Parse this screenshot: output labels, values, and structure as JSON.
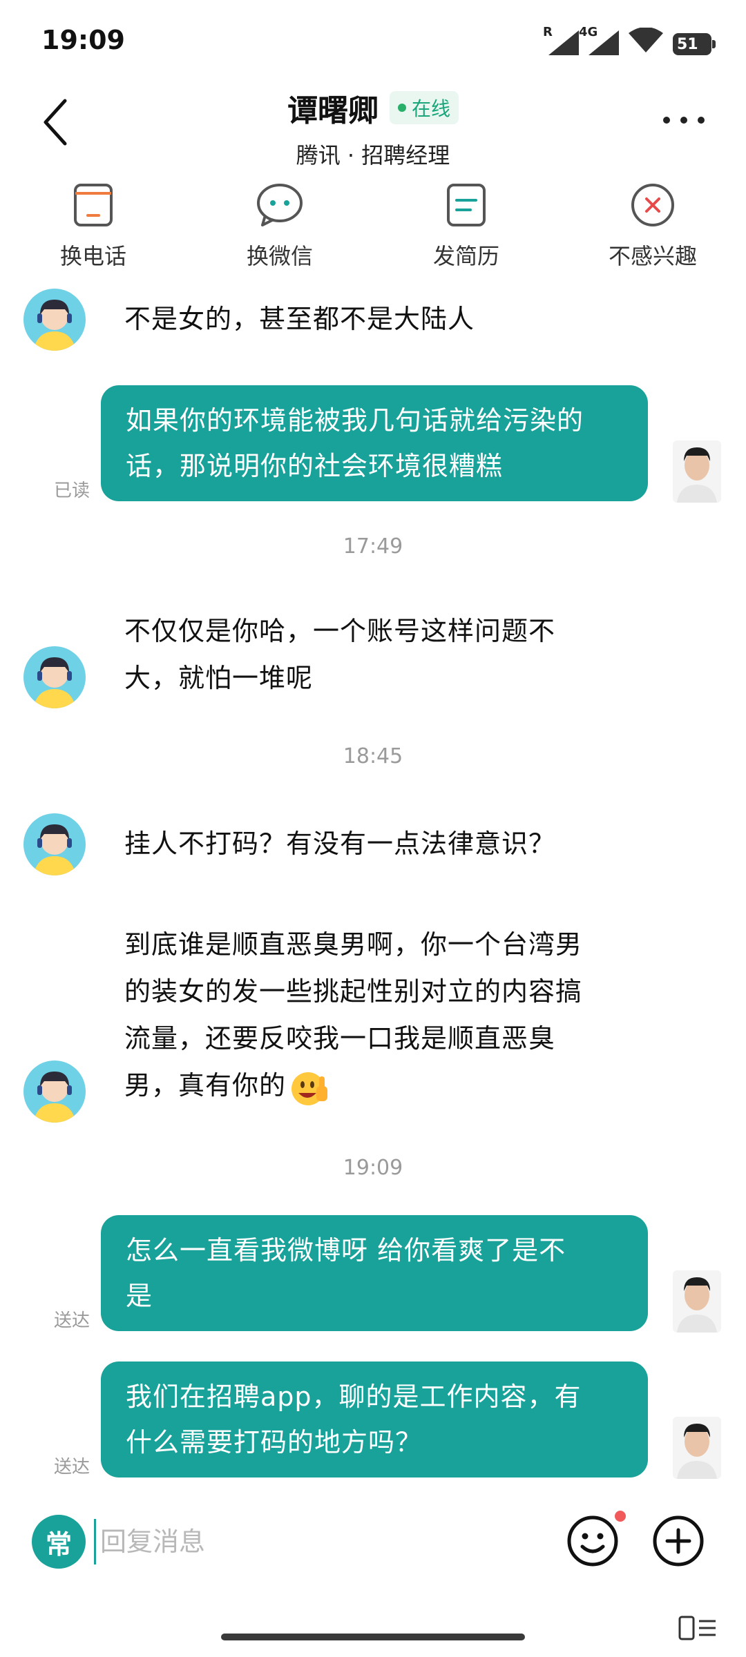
{
  "status_bar": {
    "time": "19:09",
    "signal1_tag": "R",
    "signal2_tag": "4G",
    "battery": "51"
  },
  "header": {
    "name": "谭曙卿",
    "online": "在线",
    "subtitle": "腾讯 · 招聘经理"
  },
  "actions": [
    {
      "label": "换电话",
      "icon": "phone-icon"
    },
    {
      "label": "换微信",
      "icon": "wechat-icon"
    },
    {
      "label": "发简历",
      "icon": "resume-icon"
    },
    {
      "label": "不感兴趣",
      "icon": "not-interested-icon"
    }
  ],
  "messages": {
    "m1": {
      "lines": [
        "不是女的，甚至都不是大陆人"
      ]
    },
    "m2": {
      "lines": [
        "如果你的环境能被我几句话就给污染的",
        "话，那说明你的社会环境很糟糕"
      ],
      "status": "已读"
    },
    "t1": "17:49",
    "m3": {
      "lines": [
        "不仅仅是你哈，一个账号这样问题不",
        "大，就怕一堆呢"
      ]
    },
    "t2": "18:45",
    "m4": {
      "lines": [
        "挂人不打码？有没有一点法律意识？"
      ]
    },
    "m5": {
      "lines": [
        "到底谁是顺直恶臭男啊，你一个台湾男",
        "的装女的发一些挑起性别对立的内容搞",
        "流量，还要反咬我一口我是顺直恶臭",
        "男，真有你的"
      ]
    },
    "t3": "19:09",
    "m6": {
      "lines": [
        "怎么一直看我微博呀 给你看爽了是不",
        "是"
      ],
      "status": "送达"
    },
    "m7": {
      "lines": [
        "我们在招聘app，聊的是工作内容，有",
        "什么需要打码的地方吗？"
      ],
      "status": "送达"
    }
  },
  "input": {
    "common_label": "常",
    "placeholder": "回复消息"
  },
  "colors": {
    "accent": "#18a29a",
    "online": "#28b06a",
    "muted": "#9a9a9a"
  }
}
